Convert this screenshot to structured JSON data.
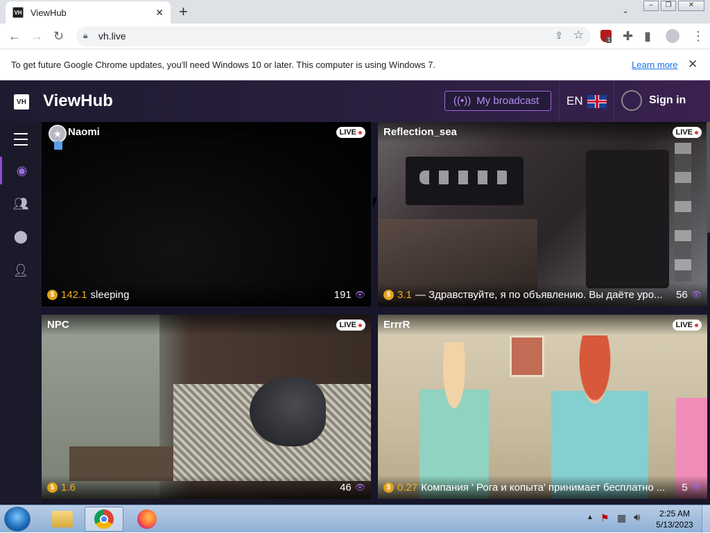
{
  "browser": {
    "tab_title": "ViewHub",
    "tab_favicon": "VH",
    "url": "vh.live",
    "extension_badge": "1",
    "infobar_message": "To get future Google Chrome updates, you'll need Windows 10 or later. This computer is using Windows 7.",
    "infobar_link": "Learn more"
  },
  "site": {
    "logo_text": "VH",
    "brand": "ViewHub",
    "my_broadcast": "My broadcast",
    "language": "EN",
    "sign_in": "Sign in",
    "accent_color": "#9f6be0"
  },
  "streams": [
    {
      "name": "Naomi",
      "live": "LIVE",
      "tokens": "142.1",
      "subject": "sleeping",
      "viewers": "191"
    },
    {
      "name": "Reflection_sea",
      "live": "LIVE",
      "tokens": "3.1",
      "subject": "— Здравствуйте, я по объявлению. Вы даёте уро...",
      "viewers": "56"
    },
    {
      "name": "NPC",
      "live": "LIVE",
      "tokens": "1.6",
      "subject": "",
      "viewers": "46"
    },
    {
      "name": "ErrrR",
      "live": "LIVE",
      "tokens": "0.27",
      "subject": "Компания ' Рога и копыта' принимает бесплатно ...",
      "viewers": "5"
    }
  ],
  "taskbar": {
    "time": "2:25 AM",
    "date": "5/13/2023"
  }
}
